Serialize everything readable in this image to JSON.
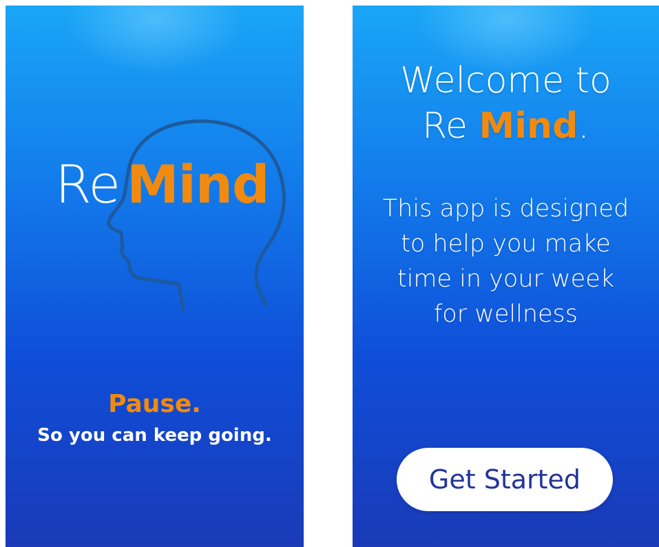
{
  "splash": {
    "brand_re": "Re",
    "brand_mind": "Mind",
    "pause": "Pause.",
    "tagline": "So you can keep going."
  },
  "welcome": {
    "line1": "Welcome to",
    "brand_re": "Re ",
    "brand_mind": "Mind",
    "period": ".",
    "description_lines": [
      "This app is designed",
      "to help you make",
      "time in your week",
      "for wellness"
    ],
    "get_started_label": "Get Started"
  },
  "icons": {
    "head": "head-profile-icon"
  },
  "colors": {
    "accent": "#f28a0f",
    "background_top": "#1aa6f7",
    "background_bottom": "#1a3ab8",
    "button_text": "#22339a",
    "head_outline": "#1d5a9e"
  }
}
